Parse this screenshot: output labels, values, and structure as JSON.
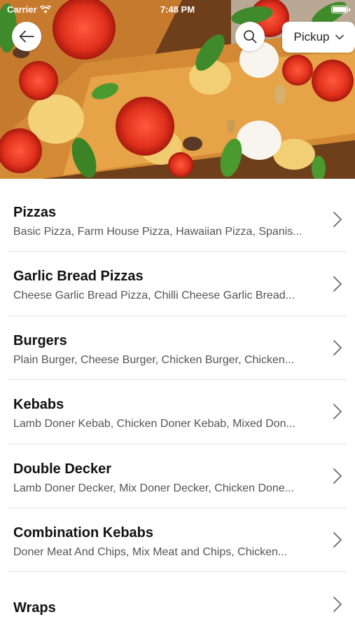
{
  "status_bar": {
    "carrier": "Carrier",
    "time": "7:48 PM"
  },
  "header": {
    "pickup_label": "Pickup",
    "back_icon": "arrow-left-icon",
    "search_icon": "search-icon",
    "chevron_icon": "chevron-down-icon"
  },
  "colors": {
    "chevron": "#6b6b6b",
    "divider": "#e4e4e4",
    "title": "#111111",
    "subtitle": "#555555"
  },
  "menu": {
    "items": [
      {
        "title": "Pizzas",
        "subtitle": "Basic Pizza, Farm House Pizza, Hawaiian Pizza, Spanis..."
      },
      {
        "title": "Garlic Bread Pizzas",
        "subtitle": "Cheese Garlic Bread Pizza, Chilli Cheese Garlic Bread..."
      },
      {
        "title": "Burgers",
        "subtitle": "Plain Burger, Cheese Burger, Chicken Burger, Chicken..."
      },
      {
        "title": "Kebabs",
        "subtitle": "Lamb Doner Kebab, Chicken Doner Kebab, Mixed Don..."
      },
      {
        "title": "Double Decker",
        "subtitle": "Lamb Doner Decker, Mix Doner Decker, Chicken Done..."
      },
      {
        "title": "Combination Kebabs",
        "subtitle": "Doner Meat And Chips, Mix Meat and Chips, Chicken..."
      },
      {
        "title": "Wraps",
        "subtitle": ""
      }
    ]
  }
}
